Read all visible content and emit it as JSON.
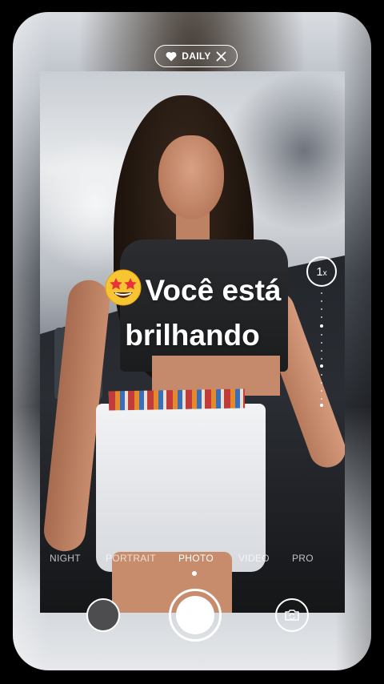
{
  "pill": {
    "label": "DAILY",
    "icon_left": "heart-icon",
    "icon_right": "close-icon"
  },
  "headline": {
    "emoji": "star-struck-emoji",
    "line1": "Você está",
    "line2": "brilhando"
  },
  "zoom": {
    "value": "1",
    "suffix": "x"
  },
  "modes": [
    {
      "label": "NIGHT",
      "active": false
    },
    {
      "label": "PORTRAIT",
      "active": false
    },
    {
      "label": "PHOTO",
      "active": true
    },
    {
      "label": "VIDEO",
      "active": false
    },
    {
      "label": "PRO",
      "active": false
    }
  ],
  "controls": {
    "gallery_icon": "gallery-thumbnail",
    "shutter_icon": "shutter-button",
    "flip_icon": "camera-flip-icon"
  },
  "colors": {
    "accent": "#ffffff",
    "background": "#000000"
  }
}
